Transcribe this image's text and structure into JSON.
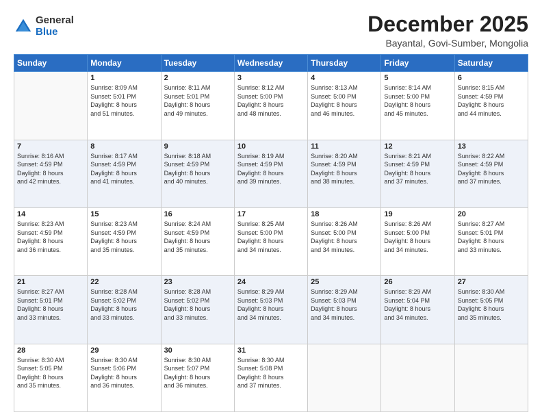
{
  "logo": {
    "general": "General",
    "blue": "Blue"
  },
  "header": {
    "title": "December 2025",
    "subtitle": "Bayantal, Govi-Sumber, Mongolia"
  },
  "days_of_week": [
    "Sunday",
    "Monday",
    "Tuesday",
    "Wednesday",
    "Thursday",
    "Friday",
    "Saturday"
  ],
  "weeks": [
    [
      {
        "day": "",
        "info": ""
      },
      {
        "day": "1",
        "info": "Sunrise: 8:09 AM\nSunset: 5:01 PM\nDaylight: 8 hours\nand 51 minutes."
      },
      {
        "day": "2",
        "info": "Sunrise: 8:11 AM\nSunset: 5:01 PM\nDaylight: 8 hours\nand 49 minutes."
      },
      {
        "day": "3",
        "info": "Sunrise: 8:12 AM\nSunset: 5:00 PM\nDaylight: 8 hours\nand 48 minutes."
      },
      {
        "day": "4",
        "info": "Sunrise: 8:13 AM\nSunset: 5:00 PM\nDaylight: 8 hours\nand 46 minutes."
      },
      {
        "day": "5",
        "info": "Sunrise: 8:14 AM\nSunset: 5:00 PM\nDaylight: 8 hours\nand 45 minutes."
      },
      {
        "day": "6",
        "info": "Sunrise: 8:15 AM\nSunset: 4:59 PM\nDaylight: 8 hours\nand 44 minutes."
      }
    ],
    [
      {
        "day": "7",
        "info": "Sunrise: 8:16 AM\nSunset: 4:59 PM\nDaylight: 8 hours\nand 42 minutes."
      },
      {
        "day": "8",
        "info": "Sunrise: 8:17 AM\nSunset: 4:59 PM\nDaylight: 8 hours\nand 41 minutes."
      },
      {
        "day": "9",
        "info": "Sunrise: 8:18 AM\nSunset: 4:59 PM\nDaylight: 8 hours\nand 40 minutes."
      },
      {
        "day": "10",
        "info": "Sunrise: 8:19 AM\nSunset: 4:59 PM\nDaylight: 8 hours\nand 39 minutes."
      },
      {
        "day": "11",
        "info": "Sunrise: 8:20 AM\nSunset: 4:59 PM\nDaylight: 8 hours\nand 38 minutes."
      },
      {
        "day": "12",
        "info": "Sunrise: 8:21 AM\nSunset: 4:59 PM\nDaylight: 8 hours\nand 37 minutes."
      },
      {
        "day": "13",
        "info": "Sunrise: 8:22 AM\nSunset: 4:59 PM\nDaylight: 8 hours\nand 37 minutes."
      }
    ],
    [
      {
        "day": "14",
        "info": "Sunrise: 8:23 AM\nSunset: 4:59 PM\nDaylight: 8 hours\nand 36 minutes."
      },
      {
        "day": "15",
        "info": "Sunrise: 8:23 AM\nSunset: 4:59 PM\nDaylight: 8 hours\nand 35 minutes."
      },
      {
        "day": "16",
        "info": "Sunrise: 8:24 AM\nSunset: 4:59 PM\nDaylight: 8 hours\nand 35 minutes."
      },
      {
        "day": "17",
        "info": "Sunrise: 8:25 AM\nSunset: 5:00 PM\nDaylight: 8 hours\nand 34 minutes."
      },
      {
        "day": "18",
        "info": "Sunrise: 8:26 AM\nSunset: 5:00 PM\nDaylight: 8 hours\nand 34 minutes."
      },
      {
        "day": "19",
        "info": "Sunrise: 8:26 AM\nSunset: 5:00 PM\nDaylight: 8 hours\nand 34 minutes."
      },
      {
        "day": "20",
        "info": "Sunrise: 8:27 AM\nSunset: 5:01 PM\nDaylight: 8 hours\nand 33 minutes."
      }
    ],
    [
      {
        "day": "21",
        "info": "Sunrise: 8:27 AM\nSunset: 5:01 PM\nDaylight: 8 hours\nand 33 minutes."
      },
      {
        "day": "22",
        "info": "Sunrise: 8:28 AM\nSunset: 5:02 PM\nDaylight: 8 hours\nand 33 minutes."
      },
      {
        "day": "23",
        "info": "Sunrise: 8:28 AM\nSunset: 5:02 PM\nDaylight: 8 hours\nand 33 minutes."
      },
      {
        "day": "24",
        "info": "Sunrise: 8:29 AM\nSunset: 5:03 PM\nDaylight: 8 hours\nand 34 minutes."
      },
      {
        "day": "25",
        "info": "Sunrise: 8:29 AM\nSunset: 5:03 PM\nDaylight: 8 hours\nand 34 minutes."
      },
      {
        "day": "26",
        "info": "Sunrise: 8:29 AM\nSunset: 5:04 PM\nDaylight: 8 hours\nand 34 minutes."
      },
      {
        "day": "27",
        "info": "Sunrise: 8:30 AM\nSunset: 5:05 PM\nDaylight: 8 hours\nand 35 minutes."
      }
    ],
    [
      {
        "day": "28",
        "info": "Sunrise: 8:30 AM\nSunset: 5:05 PM\nDaylight: 8 hours\nand 35 minutes."
      },
      {
        "day": "29",
        "info": "Sunrise: 8:30 AM\nSunset: 5:06 PM\nDaylight: 8 hours\nand 36 minutes."
      },
      {
        "day": "30",
        "info": "Sunrise: 8:30 AM\nSunset: 5:07 PM\nDaylight: 8 hours\nand 36 minutes."
      },
      {
        "day": "31",
        "info": "Sunrise: 8:30 AM\nSunset: 5:08 PM\nDaylight: 8 hours\nand 37 minutes."
      },
      {
        "day": "",
        "info": ""
      },
      {
        "day": "",
        "info": ""
      },
      {
        "day": "",
        "info": ""
      }
    ]
  ]
}
